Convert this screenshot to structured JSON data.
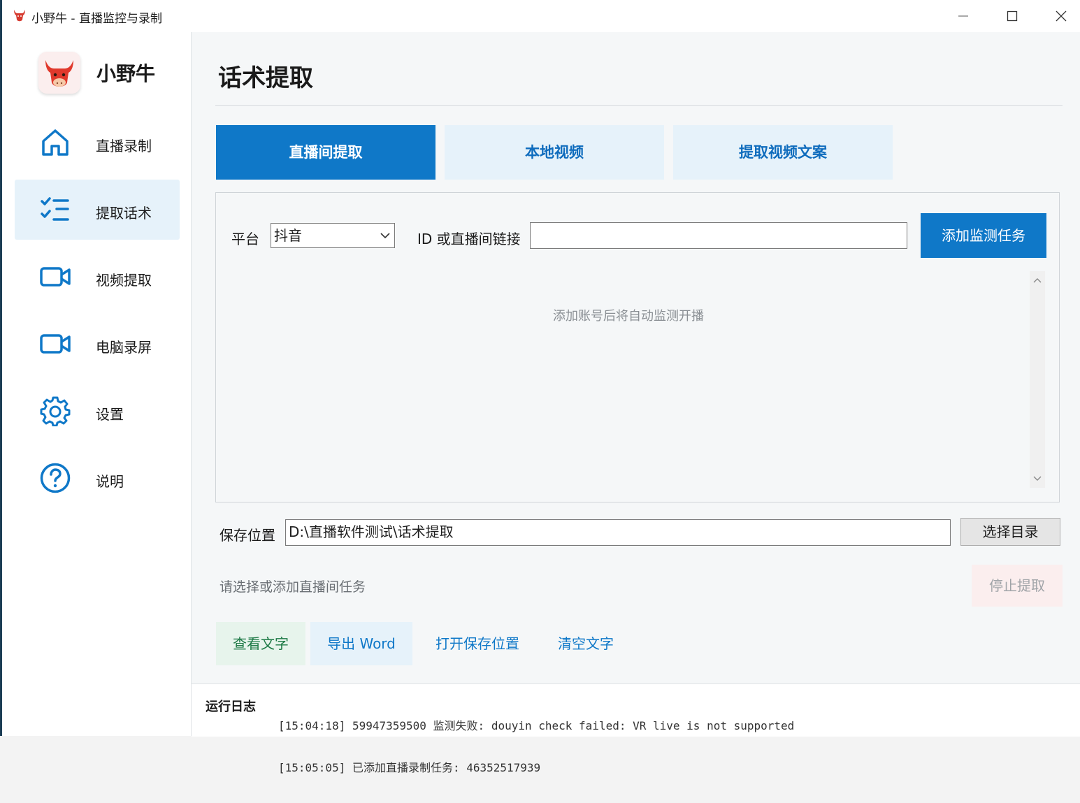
{
  "window": {
    "title": "小野牛 - 直播监控与录制"
  },
  "sidebar": {
    "brand": "小野牛",
    "items": [
      {
        "label": "直播录制",
        "icon": "home-icon",
        "active": false
      },
      {
        "label": "提取话术",
        "icon": "checklist-icon",
        "active": true
      },
      {
        "label": "视频提取",
        "icon": "video-camera-icon",
        "active": false
      },
      {
        "label": "电脑录屏",
        "icon": "video-camera-icon",
        "active": false
      },
      {
        "label": "设置",
        "icon": "gear-icon",
        "active": false
      },
      {
        "label": "说明",
        "icon": "help-icon",
        "active": false
      }
    ]
  },
  "main": {
    "title": "话术提取",
    "tabs": [
      {
        "label": "直播间提取",
        "active": true
      },
      {
        "label": "本地视频",
        "active": false
      },
      {
        "label": "提取视频文案",
        "active": false
      }
    ],
    "platform_label": "平台",
    "platform_value": "抖音",
    "id_label": "ID 或直播间链接",
    "id_value": "",
    "add_button": "添加监测任务",
    "empty_hint": "添加账号后将自动监测开播",
    "save_label": "保存位置",
    "save_path": "D:\\直播软件测试\\话术提取",
    "choose_dir_button": "选择目录",
    "status_text": "请选择或添加直播间任务",
    "stop_button": "停止提取",
    "actions": {
      "view_text": "查看文字",
      "export_word": "导出 Word",
      "open_location": "打开保存位置",
      "clear_text": "清空文字"
    }
  },
  "log": {
    "label": "运行日志",
    "lines": [
      "[15:04:18] 59947359500 监测失败: douyin check failed: VR live is not supported",
      "[15:05:05] 已添加直播录制任务: 46352517939"
    ]
  },
  "colors": {
    "accent": "#0f78c8",
    "accent_light": "#e6f2fa",
    "view_text_bg": "#e7f4ec",
    "view_text_fg": "#1e7a46",
    "stop_bg": "#fbeeee"
  }
}
